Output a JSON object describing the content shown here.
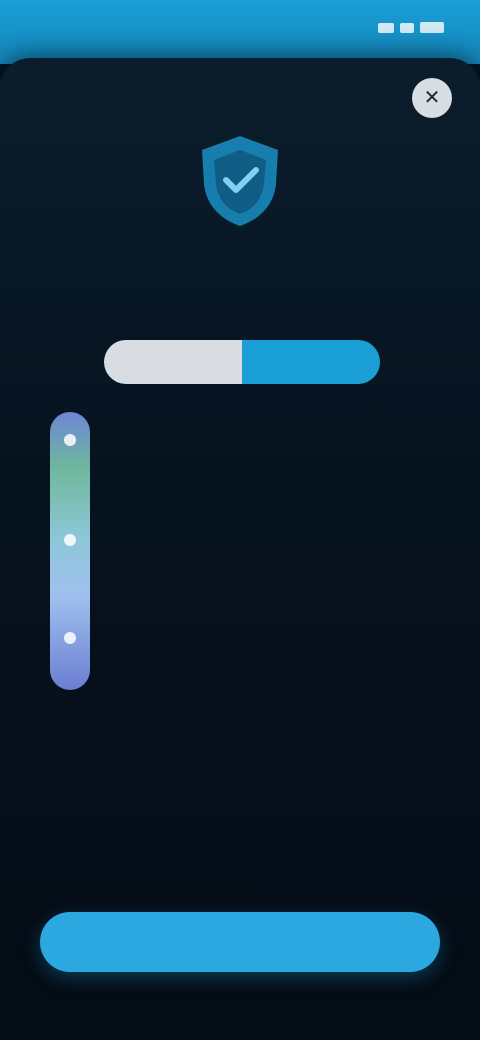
{
  "status_bar": {
    "time": "",
    "icons": [
      "signal-icon",
      "wifi-icon",
      "battery-icon"
    ]
  },
  "dialog": {
    "close_icon": "close-icon",
    "shield_icon": "shield-icon",
    "heading": "",
    "subheading": ""
  },
  "plan_toggle": {
    "options": [
      "",
      ""
    ],
    "selected_index": 0
  },
  "timeline": {
    "steps": [
      {
        "title": "",
        "description": ""
      },
      {
        "title": "",
        "description": ""
      },
      {
        "title": "",
        "description": ""
      }
    ]
  },
  "footer": {
    "terms_link": "",
    "cta_label": ""
  },
  "colors": {
    "accent": "#1a9fd6",
    "background": "#071624",
    "toggle_inactive": "#d9dde1"
  }
}
